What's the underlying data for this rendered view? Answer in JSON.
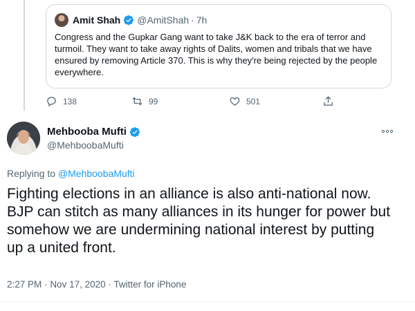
{
  "quoted_tweet": {
    "author_name": "Amit Shah",
    "handle": "@AmitShah",
    "separator": "·",
    "time": "7h",
    "text": "Congress and the Gupkar Gang want to take J&K back to the era of terror and turmoil. They want to take away rights of Dalits, women and tribals that we have ensured by removing Article 370. This is why they're being rejected by the people everywhere.",
    "reply_count": "138",
    "retweet_count": "99",
    "like_count": "501",
    "icons": {
      "reply": "reply-icon",
      "retweet": "retweet-icon",
      "like": "heart-icon",
      "share": "share-icon",
      "verified": "verified-badge-icon"
    }
  },
  "tweet": {
    "author_name": "Mehbooba Mufti",
    "handle": "@MehboobaMufti",
    "replying_prefix": "Replying to",
    "replying_to": "@MehboobaMufti",
    "text": "Fighting elections in an alliance is also anti-national now. BJP can stitch as many alliances in its hunger for power but somehow we are undermining national interest by putting up a united front.",
    "time": "2:27 PM",
    "sep1": "·",
    "date": "Nov 17, 2020",
    "sep2": "·",
    "source": "Twitter for iPhone",
    "icons": {
      "more": "more-options-icon",
      "verified": "verified-badge-icon"
    }
  },
  "colors": {
    "accent": "#1d9bf0",
    "muted": "#536471",
    "text": "#0f1419",
    "border": "#cfd9de"
  }
}
